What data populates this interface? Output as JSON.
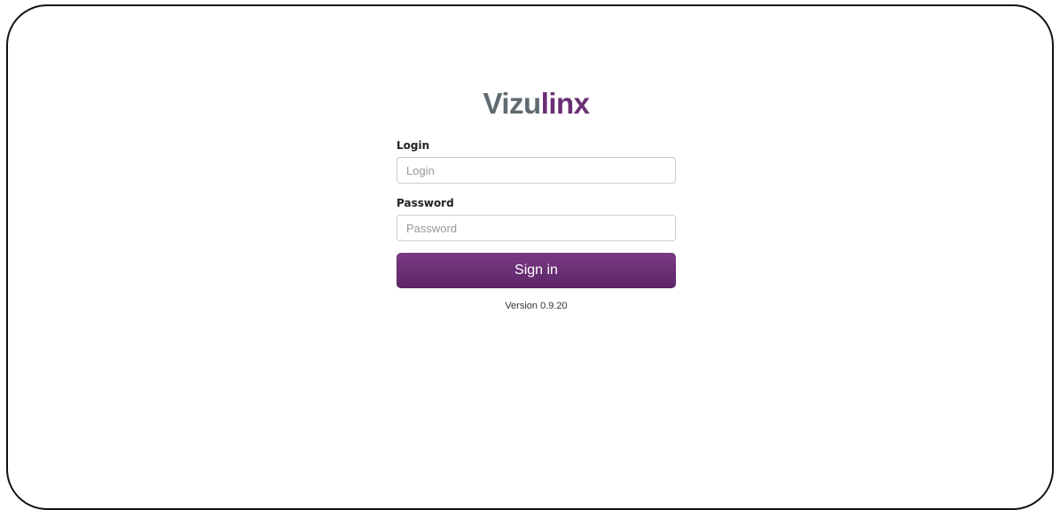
{
  "logo": {
    "part1": "Vizu",
    "part2": "linx"
  },
  "form": {
    "login_label": "Login",
    "login_placeholder": "Login",
    "login_value": "",
    "password_label": "Password",
    "password_placeholder": "Password",
    "password_value": "",
    "signin_label": "Sign in"
  },
  "footer": {
    "version": "Version 0.9.20"
  },
  "colors": {
    "brand_gray": "#5f6b70",
    "brand_purple": "#6a2e74",
    "button_top": "#7a3a84",
    "button_bottom": "#5c2566"
  }
}
